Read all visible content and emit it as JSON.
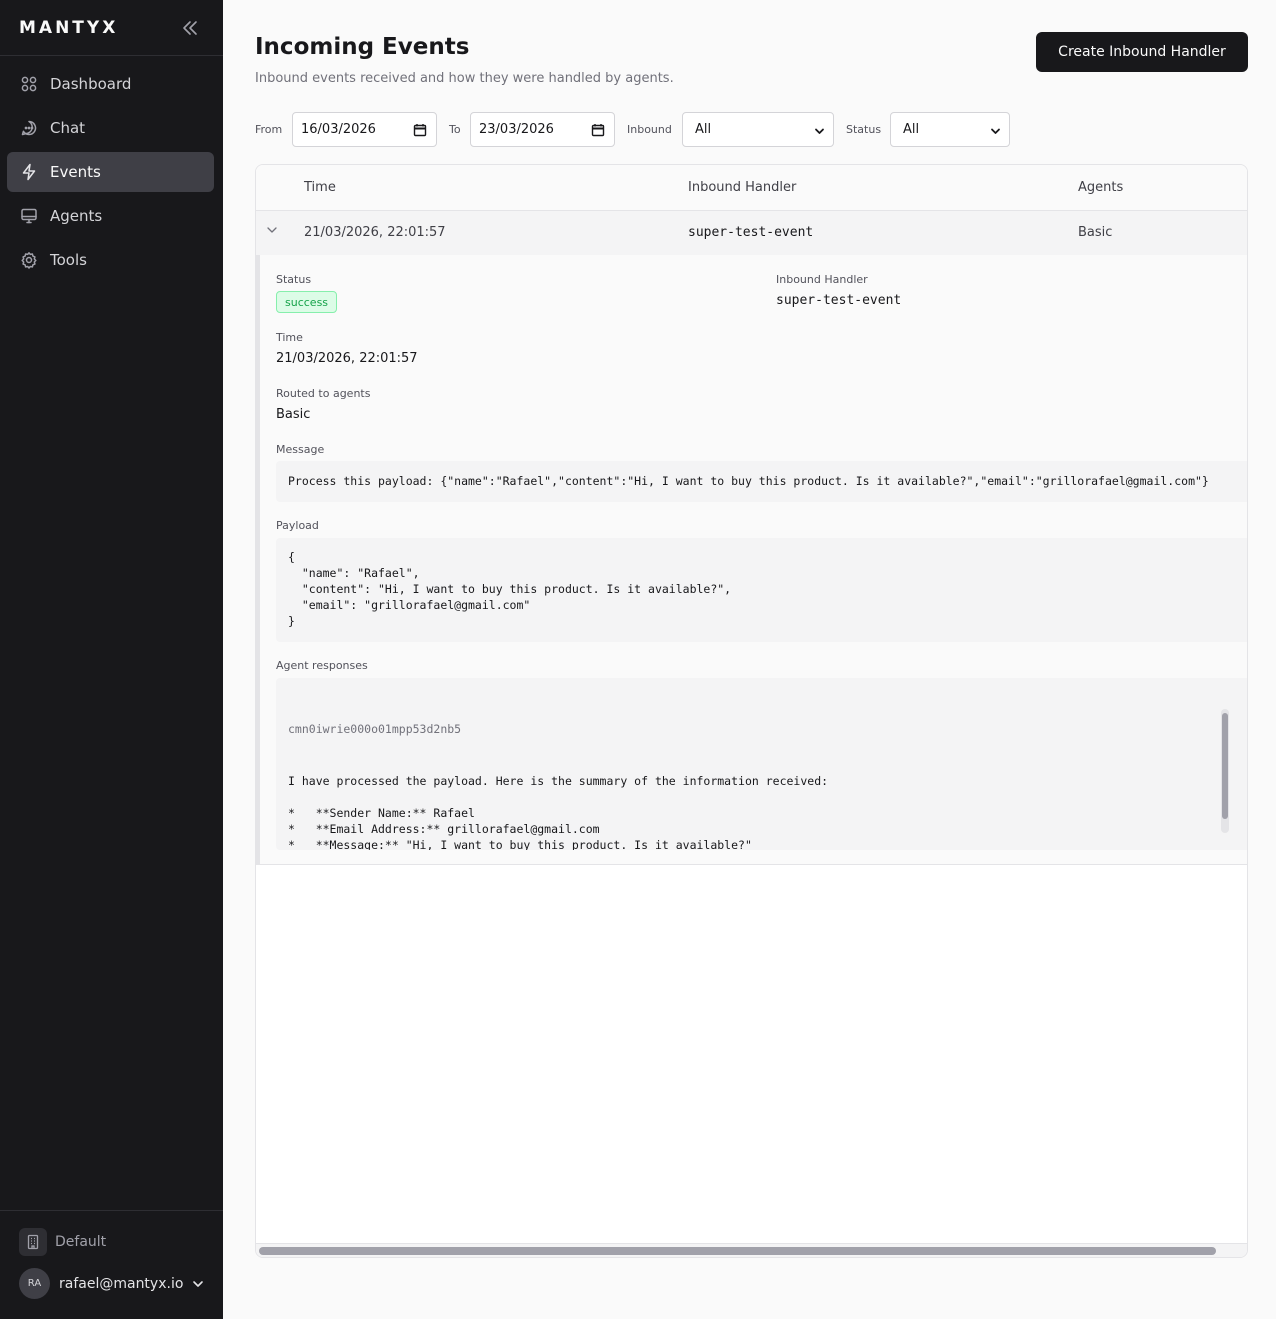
{
  "sidebar": {
    "brand": "MANTYX",
    "nav": [
      {
        "label": "Dashboard",
        "icon": "dashboard-icon"
      },
      {
        "label": "Chat",
        "icon": "chat-icon"
      },
      {
        "label": "Events",
        "icon": "lightning-icon",
        "active": true
      },
      {
        "label": "Agents",
        "icon": "monitor-icon"
      },
      {
        "label": "Tools",
        "icon": "gear-icon"
      }
    ],
    "workspace": "Default",
    "user": {
      "initials": "RA",
      "email": "rafael@mantyx.io"
    }
  },
  "header": {
    "title": "Incoming Events",
    "subtitle": "Inbound events received and how they were handled by agents.",
    "create_button": "Create Inbound Handler"
  },
  "filters": {
    "from_label": "From",
    "from_value": "16/03/2026",
    "to_label": "To",
    "to_value": "23/03/2026",
    "inbound_label": "Inbound",
    "inbound_value": "All",
    "status_label": "Status",
    "status_value": "All"
  },
  "table": {
    "columns": [
      "Time",
      "Inbound Handler",
      "Agents"
    ],
    "rows": [
      {
        "time": "21/03/2026, 22:01:57",
        "handler": "super-test-event",
        "agents": "Basic"
      }
    ]
  },
  "detail": {
    "status_label": "Status",
    "status_value": "success",
    "handler_label": "Inbound Handler",
    "handler_value": "super-test-event",
    "time_label": "Time",
    "time_value": "21/03/2026, 22:01:57",
    "routed_label": "Routed to agents",
    "routed_value": "Basic",
    "message_label": "Message",
    "message_value": "Process this payload: {\"name\":\"Rafael\",\"content\":\"Hi, I want to buy this product. Is it available?\",\"email\":\"grillorafael@gmail.com\"}",
    "payload_label": "Payload",
    "payload_value": "{\n  \"name\": \"Rafael\",\n  \"content\": \"Hi, I want to buy this product. Is it available?\",\n  \"email\": \"grillorafael@gmail.com\"\n}",
    "responses_label": "Agent responses",
    "response_id": "cmn0iwrie000o01mpp53d2nb5",
    "response_text": "I have processed the payload. Here is the summary of the information received:\n\n*   **Sender Name:** Rafael\n*   **Email Address:** grillorafael@gmail.com\n*   **Message:** \"Hi, I want to buy this product. Is it available?\"\n\n**Response for Rafael:**\n\"Hi Rafael, thank you for your interest! To give you accurate information regarding availability, could you please specify which"
  }
}
